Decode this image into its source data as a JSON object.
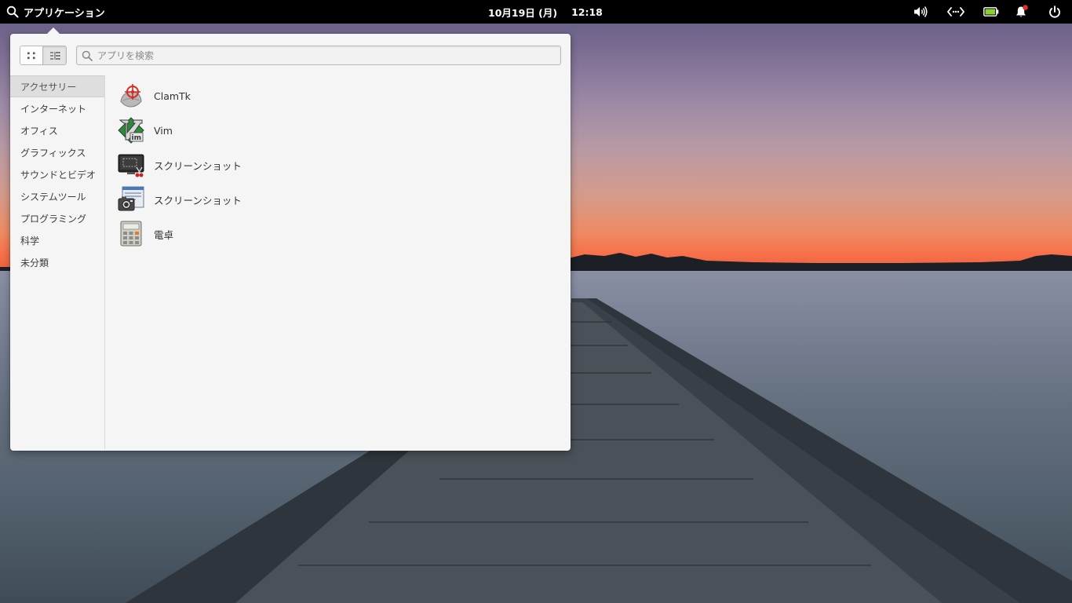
{
  "panel": {
    "apps_label": "アプリケーション",
    "date": "10月19日 (月)",
    "time": "12:18"
  },
  "indicators": [
    {
      "icon": "volume-icon"
    },
    {
      "icon": "network-icon"
    },
    {
      "icon": "battery-icon"
    },
    {
      "icon": "notifications-icon"
    },
    {
      "icon": "power-icon"
    }
  ],
  "menu": {
    "search_placeholder": "アプリを検索",
    "view_modes": [
      "grid-view",
      "category-view"
    ],
    "categories": [
      "アクセサリー",
      "インターネット",
      "オフィス",
      "グラフィックス",
      "サウンドとビデオ",
      "システムツール",
      "プログラミング",
      "科学",
      "未分類"
    ],
    "selected_category": "アクセサリー",
    "apps": [
      {
        "label": "ClamTk",
        "icon": "clamtk-icon"
      },
      {
        "label": "Vim",
        "icon": "vim-icon"
      },
      {
        "label": "スクリーンショット",
        "icon": "screenshot-icon"
      },
      {
        "label": "スクリーンショット",
        "icon": "screenshot-camera-icon"
      },
      {
        "label": "電卓",
        "icon": "calculator-icon"
      }
    ]
  },
  "colors": {
    "panel_bg": "#000000",
    "popover_bg": "#f5f5f5",
    "selected_category_bg": "#dedede",
    "notification_dot": "#e0312c",
    "battery_fill": "#8bd033"
  }
}
